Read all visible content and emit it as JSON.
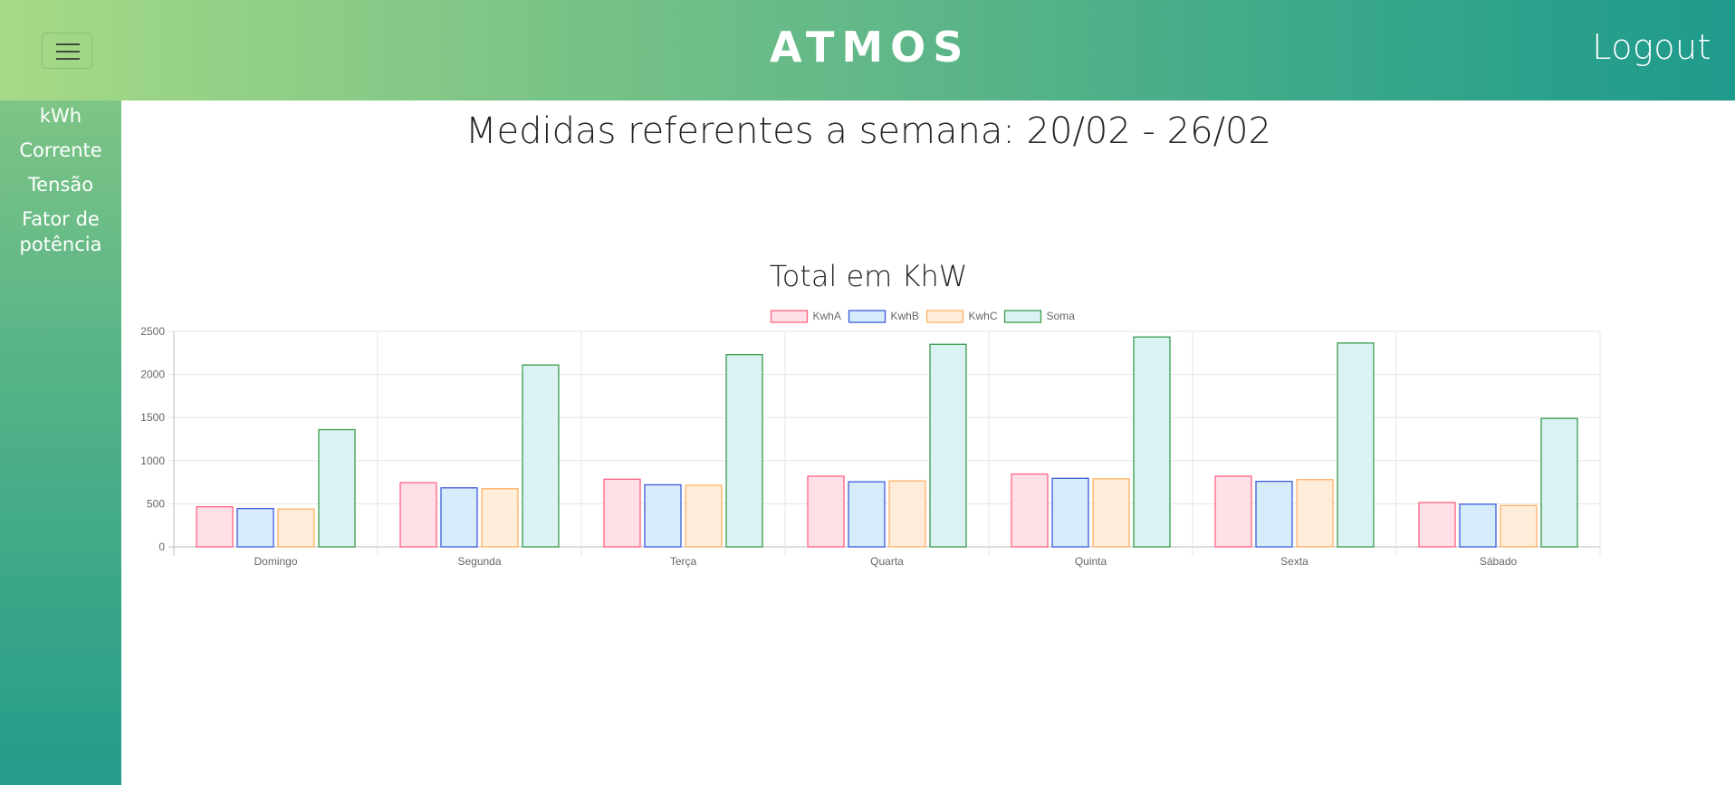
{
  "header": {
    "logo_text": "ATMOS",
    "logout_label": "Logout"
  },
  "sidebar": {
    "items": [
      {
        "label": "kWh"
      },
      {
        "label": "Corrente"
      },
      {
        "label": "Tensão"
      },
      {
        "label": "Fator de potência"
      }
    ]
  },
  "main": {
    "page_title": "Medidas referentes a semana: 20/02 - 26/02",
    "chart_title": "Total em KhW"
  },
  "colors": {
    "header_start": "#a6da86",
    "header_end": "#1e9a8c"
  },
  "chart_data": {
    "type": "bar",
    "title": "Total em KhW",
    "xlabel": "",
    "ylabel": "",
    "categories": [
      "Domingo",
      "Segunda",
      "Terça",
      "Quarta",
      "Quinta",
      "Sexta",
      "Sábado"
    ],
    "ylim": [
      0,
      2500
    ],
    "yticks": [
      0,
      500,
      1000,
      1500,
      2000,
      2500
    ],
    "grid": true,
    "legend_position": "top-center",
    "series": [
      {
        "name": "KwhA",
        "values": [
          465,
          745,
          785,
          820,
          845,
          820,
          515
        ],
        "border": "#ff6384",
        "fill": "#ffe0e6"
      },
      {
        "name": "KwhB",
        "values": [
          445,
          685,
          720,
          755,
          795,
          760,
          495
        ],
        "border": "#3b5bdb",
        "fill": "#d7ecfb"
      },
      {
        "name": "KwhC",
        "values": [
          440,
          675,
          715,
          765,
          790,
          780,
          480
        ],
        "border": "#ffb366",
        "fill": "#ffecd9"
      },
      {
        "name": "Soma",
        "values": [
          1360,
          2110,
          2230,
          2350,
          2435,
          2365,
          1490
        ],
        "border": "#3a9c4c",
        "fill": "#dbf2f2"
      }
    ]
  }
}
